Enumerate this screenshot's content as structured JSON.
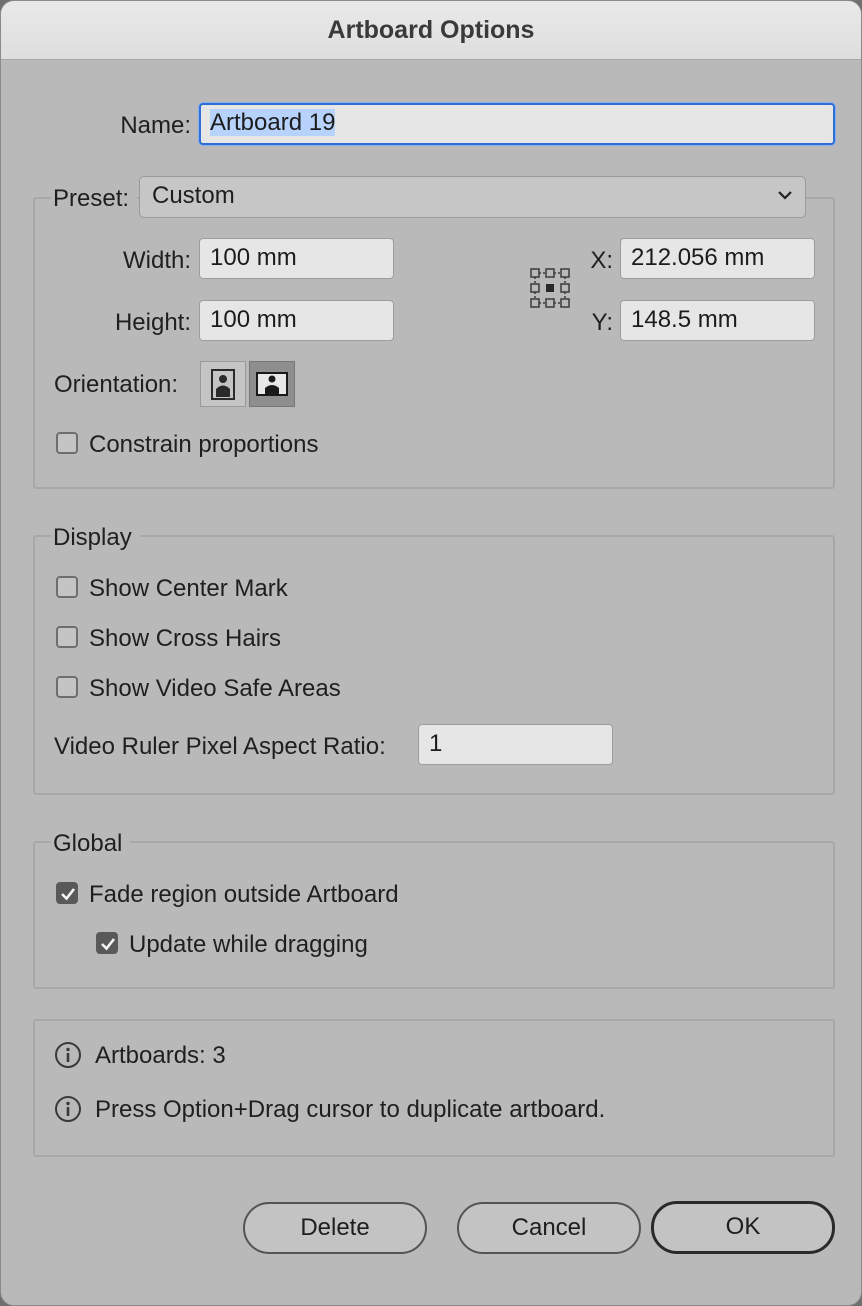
{
  "window": {
    "title": "Artboard Options"
  },
  "name_field": {
    "label": "Name:",
    "value": "Artboard 19"
  },
  "preset": {
    "label": "Preset:",
    "selected": "Custom",
    "width_label": "Width:",
    "width_value": "100 mm",
    "height_label": "Height:",
    "height_value": "100 mm",
    "x_label": "X:",
    "x_value": "212.056 mm",
    "y_label": "Y:",
    "y_value": "148.5 mm",
    "orientation_label": "Orientation:",
    "orientation_selected": "landscape",
    "constrain_label": "Constrain proportions",
    "constrain_checked": false,
    "reference_point_icon": "reference-point-grid-icon"
  },
  "display": {
    "title": "Display",
    "options": [
      {
        "label": "Show Center Mark",
        "checked": false
      },
      {
        "label": "Show Cross Hairs",
        "checked": false
      },
      {
        "label": "Show Video Safe Areas",
        "checked": false
      }
    ],
    "pixel_ratio_label": "Video Ruler Pixel Aspect Ratio:",
    "pixel_ratio_value": "1"
  },
  "global": {
    "title": "Global",
    "fade_label": "Fade region outside Artboard",
    "fade_checked": true,
    "update_label": "Update while dragging",
    "update_checked": true
  },
  "info": {
    "artboards_text": "Artboards: 3",
    "hint_text": "Press Option+Drag cursor to duplicate artboard.",
    "icon": "info-icon"
  },
  "buttons": {
    "delete": "Delete",
    "cancel": "Cancel",
    "ok": "OK"
  },
  "colors": {
    "dialog_bg": "#b9b9b9",
    "focus_ring": "#2f6fd3",
    "selection": "#b7d3fb"
  }
}
